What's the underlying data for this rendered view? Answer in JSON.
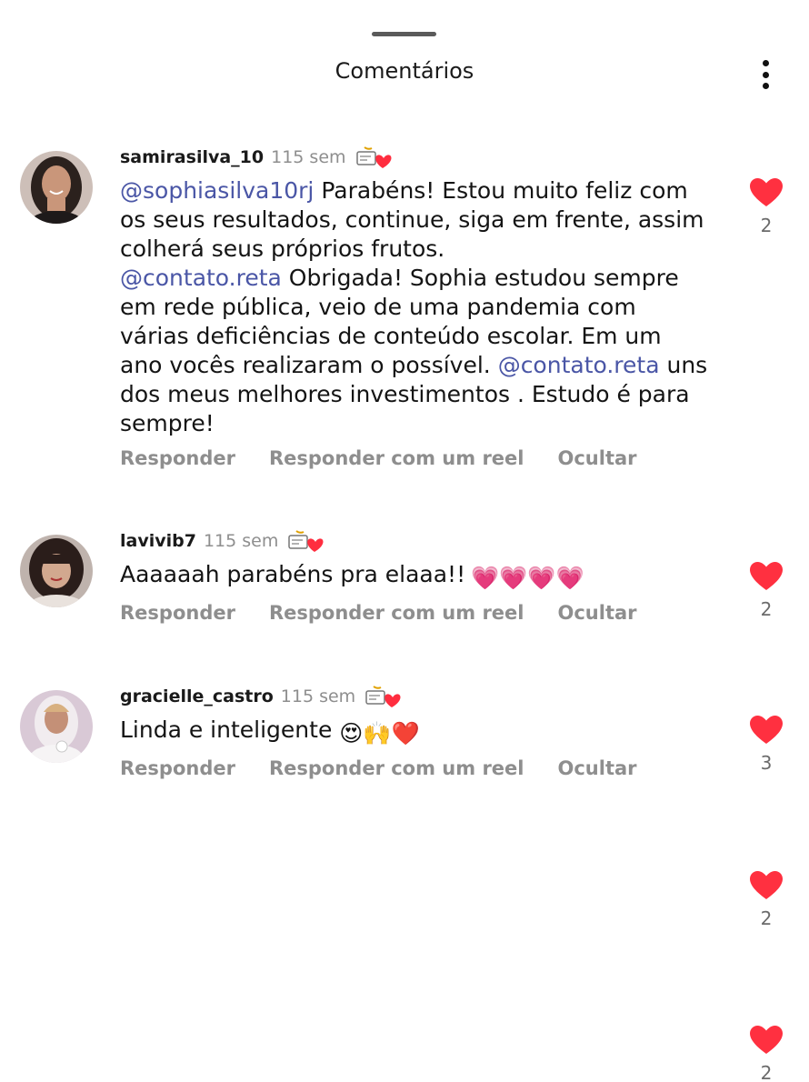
{
  "header": {
    "title": "Comentários",
    "more_icon": "more-vertical-icon"
  },
  "comments": [
    {
      "username": "samirasilva_10",
      "time": "115 sem",
      "badge_icon": "celebration-heart-icon",
      "mention1": "@sophiasilva10rj",
      "text1": " Parabéns! Estou muito feliz com os seus resultados, continue, siga em frente, assim colherá  seus próprios frutos.",
      "mention2": "@contato.reta",
      "text2": " Obrigada! Sophia estudou sempre em rede pública, veio de uma pandemia com várias deficiências  de conteúdo escolar. Em um ano vocês  realizaram o possível.",
      "mention3": "@contato.reta",
      "text3": " uns dos meus melhores investimentos . Estudo é para sempre!",
      "likes": "2"
    },
    {
      "username": "lavivib7",
      "time": "115 sem",
      "badge_icon": "celebration-heart-icon",
      "text": "Aaaaaah parabéns pra elaaa!!",
      "emojis": "💗💗💗💗",
      "likes": "2"
    },
    {
      "username": "gracielle_castro",
      "time": "115 sem",
      "badge_icon": "celebration-heart-icon",
      "text": "Linda e inteligente",
      "emojis": "😍🙌❤️",
      "likes": "3"
    }
  ],
  "actions": {
    "reply": "Responder",
    "reply_reel": "Responder com um reel",
    "hide": "Ocultar"
  },
  "extra_likes": [
    "2",
    "2"
  ],
  "colors": {
    "like_red": "#ff3040",
    "mention_blue": "#4a56a6",
    "secondary_gray": "#8e8e8e"
  }
}
